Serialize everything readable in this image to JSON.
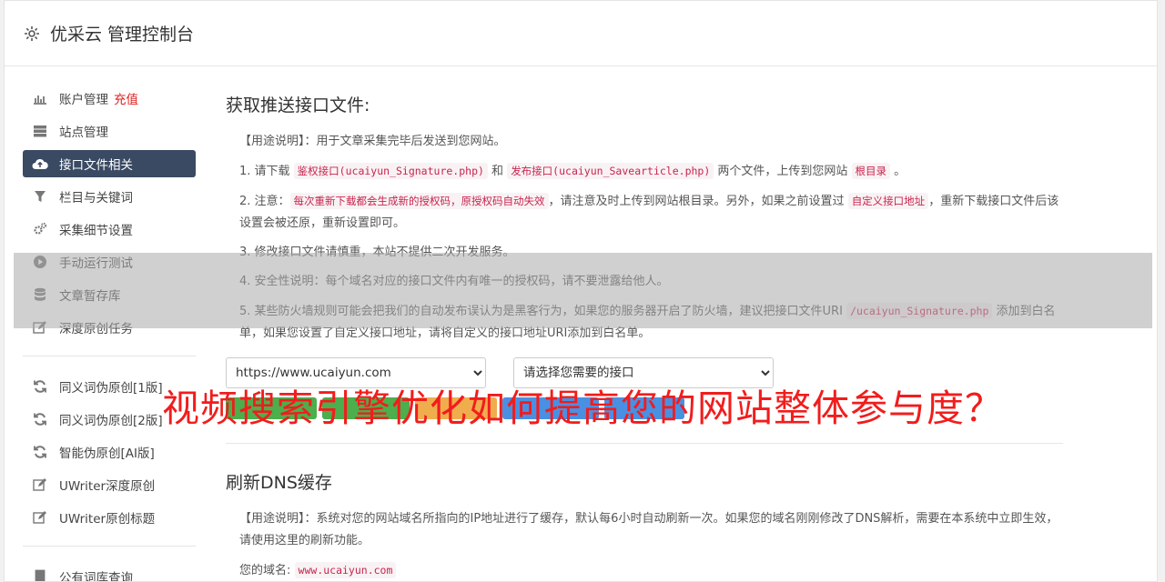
{
  "app": {
    "title": "优采云 管理控制台",
    "icon": "gear-icon"
  },
  "sidebar": {
    "group1": [
      {
        "label": "账户管理",
        "badge": "充值",
        "icon": "bar-chart-icon"
      },
      {
        "label": "站点管理",
        "icon": "server-icon"
      },
      {
        "label": "接口文件相关",
        "icon": "cloud-upload-icon",
        "active": true
      },
      {
        "label": "栏目与关键词",
        "icon": "filter-icon"
      },
      {
        "label": "采集细节设置",
        "icon": "cogs-icon"
      },
      {
        "label": "手动运行测试",
        "icon": "play-circle-icon"
      },
      {
        "label": "文章暂存库",
        "icon": "database-icon"
      },
      {
        "label": "深度原创任务",
        "icon": "edit-icon"
      }
    ],
    "group2": [
      {
        "label": "同义词伪原创[1版]",
        "icon": "refresh-icon"
      },
      {
        "label": "同义词伪原创[2版]",
        "icon": "refresh-icon"
      },
      {
        "label": "智能伪原创[AI版]",
        "icon": "refresh-icon"
      },
      {
        "label": "UWriter深度原创",
        "icon": "edit-icon"
      },
      {
        "label": "UWriter原创标题",
        "icon": "edit-icon"
      }
    ],
    "group3": [
      {
        "label": "公有词库查询",
        "icon": "book-icon"
      }
    ]
  },
  "section1": {
    "title": "获取推送接口文件:",
    "usage": "【用途说明】：用于文章采集完毕后发送到您网站。",
    "item1": {
      "pre": "1. 请下载 ",
      "code1": "鉴权接口(ucaiyun_Signature.php)",
      "mid": " 和 ",
      "code2": "发布接口(ucaiyun_Savearticle.php)",
      "post": " 两个文件，上传到您网站 ",
      "code3": "根目录",
      "end": " 。"
    },
    "item2": {
      "pre": "2. 注意：",
      "code1": "每次重新下载都会生成新的授权码，原授权码自动失效",
      "mid": "，请注意及时上传到网站根目录。另外，如果之前设置过 ",
      "code2": "自定义接口地址",
      "post": "，重新下载接口文件后该设置会被还原，重新设置即可。"
    },
    "item3": "3. 修改接口文件请慎重，本站不提供二次开发服务。",
    "item4": "4. 安全性说明：每个域名对应的接口文件内有唯一的授权码，请不要泄露给他人。",
    "item5": {
      "pre": "5. 某些防火墙规则可能会把我们的自动发布误认为是黑客行为，如果您的服务器开启了防火墙，建议把接口文件URI ",
      "code": "/ucaiyun_Signature.php",
      "post": " 添加到白名单，如果您设置了自定义接口地址，请将自定义的接口地址URI添加到白名单。"
    },
    "site_select_value": "https://www.ucaiyun.com",
    "api_select_value": "请选择您需要的接口"
  },
  "section2": {
    "title": "刷新DNS缓存",
    "usage": "【用途说明】：系统对您的网站域名所指向的IP地址进行了缓存，默认每6小时自动刷新一次。如果您的域名刚刚修改了DNS解析，需要在本系统中立即生效，请使用这里的刷新功能。",
    "domain_label": "您的域名:",
    "domain_value": "www.ucaiyun.com"
  },
  "overlay_title": "视频搜索引擎优化如何提高您的网站整体参与度？",
  "colors": {
    "active_nav": "#3a4a63",
    "overlay_text": "#f21c1c",
    "code_text": "#c7254e"
  }
}
